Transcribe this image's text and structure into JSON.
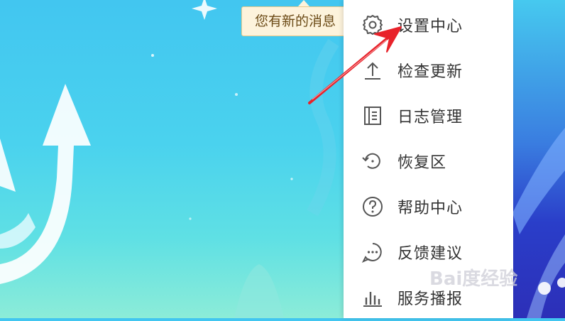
{
  "notification": {
    "text": "您有新的消息"
  },
  "menu": {
    "items": [
      {
        "label": "设置中心",
        "icon": "gear-icon"
      },
      {
        "label": "检查更新",
        "icon": "upload-icon"
      },
      {
        "label": "日志管理",
        "icon": "log-icon"
      },
      {
        "label": "恢复区",
        "icon": "restore-icon"
      },
      {
        "label": "帮助中心",
        "icon": "help-icon"
      },
      {
        "label": "反馈建议",
        "icon": "chat-icon"
      },
      {
        "label": "服务播报",
        "icon": "bar-chart-icon"
      }
    ]
  },
  "watermark": {
    "text": "Bai度经验"
  },
  "colors": {
    "menu_text": "#333333",
    "icon_stroke": "#555555",
    "arrow": "#e8222a",
    "notice_bg": "#fdf3dc"
  }
}
